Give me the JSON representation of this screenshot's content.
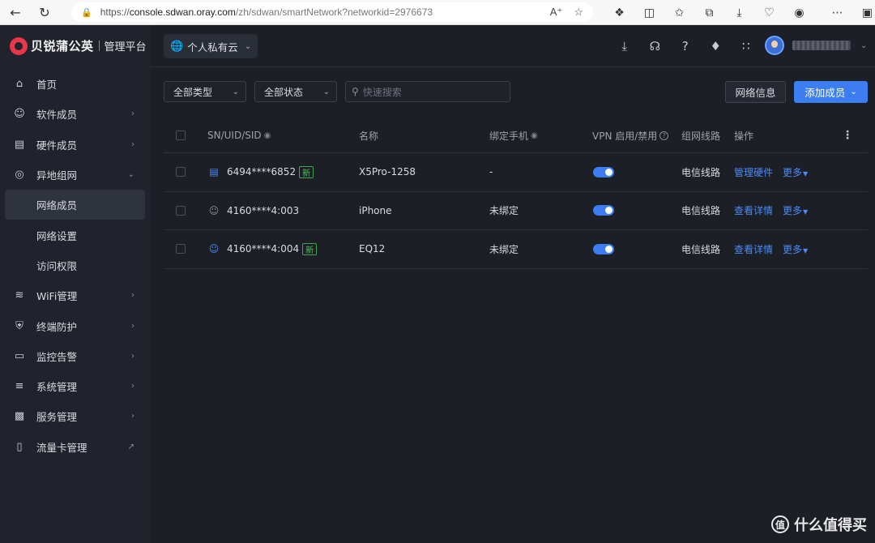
{
  "browser": {
    "url_prefix": "https://",
    "url_host": "console.sdwan.oray.com",
    "url_path": "/zh/sdwan/smartNetwork?networkid=2976673"
  },
  "brand": {
    "name": "贝锐蒲公英",
    "subtitle": "管理平台"
  },
  "sidebar": {
    "items": [
      {
        "label": "首页",
        "icon": "home-icon"
      },
      {
        "label": "软件成员",
        "icon": "user-icon",
        "chevron": true
      },
      {
        "label": "硬件成员",
        "icon": "router-icon",
        "chevron": true
      },
      {
        "label": "异地组网",
        "icon": "network-icon",
        "expanded": true
      },
      {
        "label": "网络成员",
        "sub": true,
        "active": true
      },
      {
        "label": "网络设置",
        "sub": true
      },
      {
        "label": "访问权限",
        "sub": true
      },
      {
        "label": "WiFi管理",
        "icon": "wifi-icon",
        "chevron": true
      },
      {
        "label": "终端防护",
        "icon": "shield-icon",
        "chevron": true
      },
      {
        "label": "监控告警",
        "icon": "monitor-icon",
        "chevron": true
      },
      {
        "label": "系统管理",
        "icon": "sliders-icon",
        "chevron": true
      },
      {
        "label": "服务管理",
        "icon": "service-icon",
        "chevron": true
      },
      {
        "label": "流量卡管理",
        "icon": "simcard-icon",
        "external": true
      }
    ]
  },
  "header": {
    "network_name": "个人私有云"
  },
  "filters": {
    "type_label": "全部类型",
    "status_label": "全部状态",
    "search_placeholder": "快速搜索"
  },
  "actions": {
    "network_info": "网络信息",
    "add_member": "添加成员"
  },
  "table": {
    "columns": {
      "id": "SN/UID/SID",
      "name": "名称",
      "phone": "绑定手机",
      "vpn": "VPN 启用/禁用",
      "line": "组网线路",
      "ops": "操作"
    },
    "rows": [
      {
        "id": "6494****6852",
        "is_new": true,
        "device": "router",
        "name": "X5Pro-1258",
        "phone": "-",
        "vpn_enabled": true,
        "line": "电信线路",
        "action": "管理硬件",
        "more": "更多"
      },
      {
        "id": "4160****4:003",
        "is_new": false,
        "device": "user-grey",
        "name": "iPhone",
        "phone": "未绑定",
        "vpn_enabled": true,
        "line": "电信线路",
        "action": "查看详情",
        "more": "更多"
      },
      {
        "id": "4160****4:004",
        "is_new": true,
        "device": "user",
        "name": "EQ12",
        "phone": "未绑定",
        "vpn_enabled": true,
        "line": "电信线路",
        "action": "查看详情",
        "more": "更多"
      }
    ],
    "new_tag": "新"
  },
  "watermark": {
    "logo": "值",
    "text": "什么值得买"
  }
}
